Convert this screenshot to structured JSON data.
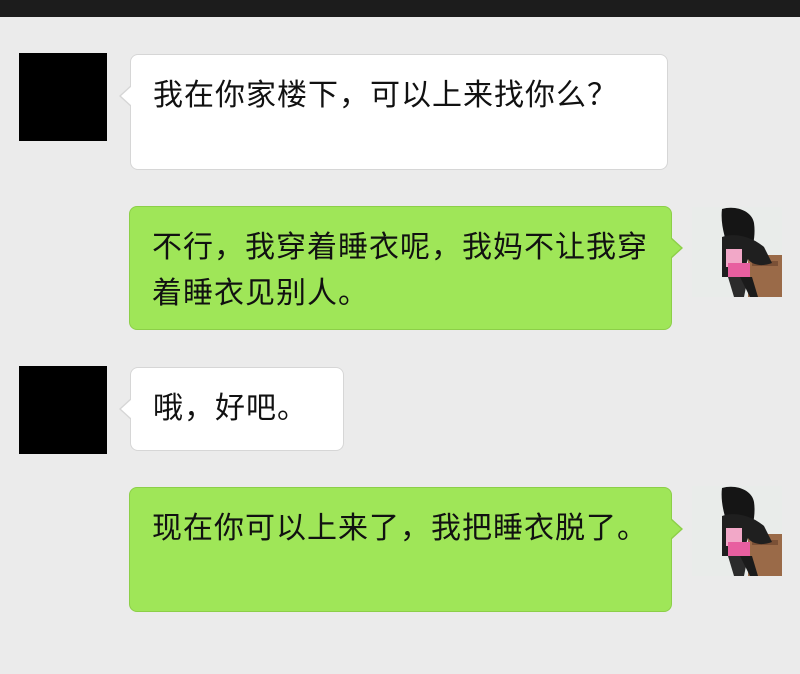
{
  "theme": {
    "background": "#ebebeb",
    "incoming_bubble": "#ffffff",
    "outgoing_bubble": "#9fe658",
    "redaction": "#000000"
  },
  "conversation": {
    "messages": [
      {
        "sender": "contact",
        "avatar": "redacted-avatar",
        "text": "我在你家楼下，可以上来找你么？"
      },
      {
        "sender": "self",
        "avatar": "user-photo-avatar",
        "text": "不行，我穿着睡衣呢，我妈不让我穿着睡衣见别人。"
      },
      {
        "sender": "contact",
        "avatar": "redacted-avatar",
        "text": "哦，好吧。"
      },
      {
        "sender": "self",
        "avatar": "user-photo-avatar",
        "text": "现在你可以上来了，我把睡衣脱了。"
      }
    ]
  }
}
